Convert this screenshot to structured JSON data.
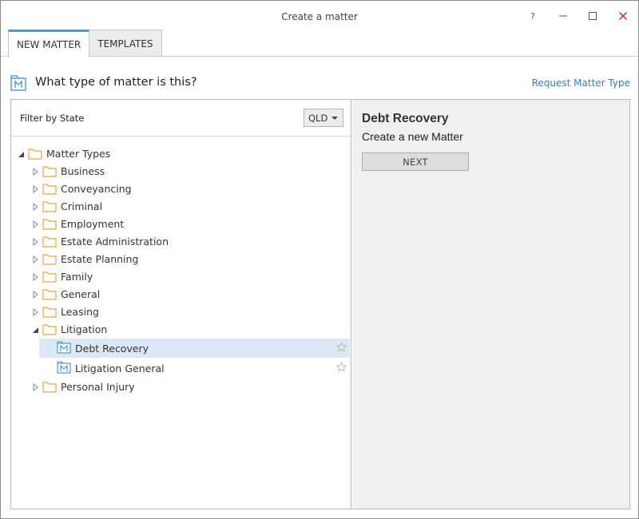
{
  "window": {
    "title": "Create a matter",
    "help_glyph": "?",
    "minimize_glyph": "–",
    "maximize_glyph": "☐",
    "close_glyph": "✕"
  },
  "tabs": [
    {
      "label": "NEW MATTER",
      "active": true
    },
    {
      "label": "TEMPLATES",
      "active": false
    }
  ],
  "header": {
    "question": "What type of matter is this?",
    "request_link": "Request Matter Type"
  },
  "filter": {
    "label": "Filter by State",
    "selected": "QLD"
  },
  "tree": {
    "root": "Matter Types",
    "children": [
      {
        "label": "Business",
        "expanded": false
      },
      {
        "label": "Conveyancing",
        "expanded": false
      },
      {
        "label": "Criminal",
        "expanded": false
      },
      {
        "label": "Employment",
        "expanded": false
      },
      {
        "label": "Estate Administration",
        "expanded": false
      },
      {
        "label": "Estate Planning",
        "expanded": false
      },
      {
        "label": "Family",
        "expanded": false
      },
      {
        "label": "General",
        "expanded": false
      },
      {
        "label": "Leasing",
        "expanded": false
      },
      {
        "label": "Litigation",
        "expanded": true,
        "children": [
          {
            "label": "Debt Recovery",
            "selected": true
          },
          {
            "label": "Litigation General",
            "selected": false
          }
        ]
      },
      {
        "label": "Personal Injury",
        "expanded": false
      }
    ]
  },
  "detail": {
    "title": "Debt Recovery",
    "subtitle": "Create a new Matter",
    "next_label": "NEXT"
  },
  "colors": {
    "accent": "#3d9ee0",
    "link": "#2f7fc8",
    "folder": "#e8a33d",
    "selection": "#dbe9f7",
    "close": "#c42b1c"
  },
  "icons": {
    "folder": "folder-icon",
    "matter": "matter-icon",
    "star": "star-icon"
  }
}
